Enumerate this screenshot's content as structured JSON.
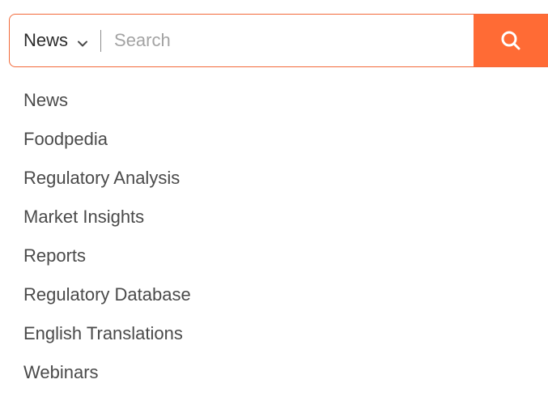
{
  "search": {
    "category_selected": "News",
    "placeholder": "Search",
    "value": "",
    "icons": {
      "chevron": "chevron-down-icon",
      "search": "search-icon"
    },
    "colors": {
      "accent": "#ff6b35",
      "border": "#f26a3a"
    }
  },
  "dropdown": {
    "items": [
      {
        "label": "News"
      },
      {
        "label": "Foodpedia"
      },
      {
        "label": "Regulatory Analysis"
      },
      {
        "label": "Market Insights"
      },
      {
        "label": "Reports"
      },
      {
        "label": "Regulatory Database"
      },
      {
        "label": "English Translations"
      },
      {
        "label": "Webinars"
      }
    ]
  }
}
